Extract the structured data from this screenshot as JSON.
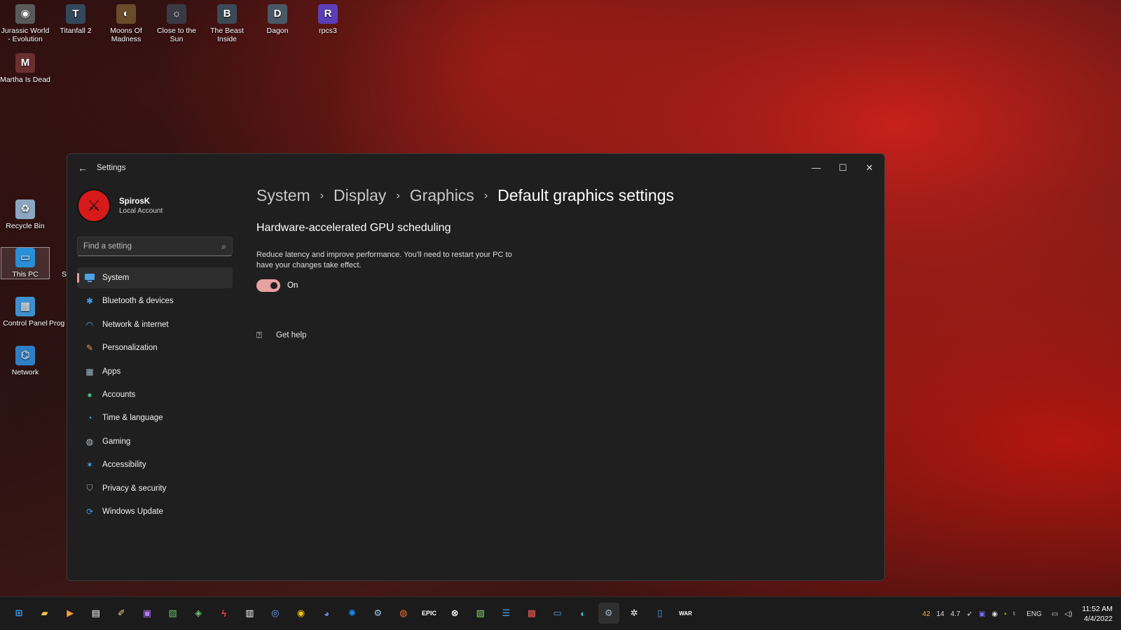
{
  "desktop": {
    "icons": [
      {
        "label": "Jurassic World - Evolution",
        "icon": "jurassic-world-icon"
      },
      {
        "label": "Titanfall 2",
        "icon": "titanfall-icon"
      },
      {
        "label": "Moons Of Madness",
        "icon": "moons-of-madness-icon"
      },
      {
        "label": "Close to the Sun",
        "icon": "close-to-the-sun-icon"
      },
      {
        "label": "The Beast Inside",
        "icon": "beast-inside-icon"
      },
      {
        "label": "Dagon",
        "icon": "dagon-icon"
      },
      {
        "label": "rpcs3",
        "icon": "rpcs3-icon"
      },
      {
        "label": "Martha Is Dead",
        "icon": "martha-is-dead-icon"
      },
      {
        "label": "Recycle Bin",
        "icon": "recycle-bin-icon"
      },
      {
        "label": "This PC",
        "icon": "this-pc-icon"
      },
      {
        "label": "Control Panel",
        "icon": "control-panel-icon"
      },
      {
        "label": "Prog",
        "icon": "program-icon"
      },
      {
        "label": "Network",
        "icon": "network-icon"
      },
      {
        "label": "S",
        "icon": "s-icon"
      }
    ]
  },
  "window": {
    "title": "Settings",
    "controls": {
      "minimize": "—",
      "maximize": "☐",
      "close": "✕"
    }
  },
  "profile": {
    "name": "SpirosK",
    "account_type": "Local Account"
  },
  "search": {
    "placeholder": "Find a setting"
  },
  "sidebar": {
    "items": [
      {
        "label": "System",
        "icon": "system-icon",
        "active": true
      },
      {
        "label": "Bluetooth & devices",
        "icon": "bluetooth-icon"
      },
      {
        "label": "Network & internet",
        "icon": "wifi-icon"
      },
      {
        "label": "Personalization",
        "icon": "brush-icon"
      },
      {
        "label": "Apps",
        "icon": "apps-icon"
      },
      {
        "label": "Accounts",
        "icon": "accounts-icon"
      },
      {
        "label": "Time & language",
        "icon": "globe-clock-icon"
      },
      {
        "label": "Gaming",
        "icon": "gamepad-icon"
      },
      {
        "label": "Accessibility",
        "icon": "accessibility-icon"
      },
      {
        "label": "Privacy & security",
        "icon": "shield-icon"
      },
      {
        "label": "Windows Update",
        "icon": "update-icon"
      }
    ]
  },
  "breadcrumb": [
    "System",
    "Display",
    "Graphics",
    "Default graphics settings"
  ],
  "main": {
    "section_title": "Hardware-accelerated GPU scheduling",
    "description": "Reduce latency and improve performance. You'll need to restart your PC to have your changes take effect.",
    "toggle": {
      "state": "On",
      "enabled": true
    },
    "help_link": "Get help"
  },
  "taskbar": {
    "apps": [
      "start-icon",
      "file-explorer-icon",
      "media-player-icon",
      "calendar-icon",
      "notes-icon",
      "app-icon",
      "photos-icon",
      "xbox-companion-icon",
      "adobe-icon",
      "mixer-icon",
      "speed-icon",
      "chrome-icon",
      "discord-icon",
      "battle-net-icon",
      "steam-icon",
      "origin-icon",
      "epic-games-icon",
      "xbox-icon",
      "notepad-icon",
      "list-icon",
      "office-icon",
      "remote-desktop-icon",
      "edge-icon",
      "settings-gear-icon",
      "control-gear-icon",
      "window-icon",
      "warzone-icon"
    ],
    "tray": {
      "items": [
        "42",
        "14",
        "4.7"
      ],
      "language": "ENG",
      "time": "11:52 AM",
      "date": "4/4/2022"
    }
  },
  "colors": {
    "window_bg": "#1f1f1f",
    "accent": "#e8a1a1",
    "taskbar_bg": "#1b1b1b"
  }
}
